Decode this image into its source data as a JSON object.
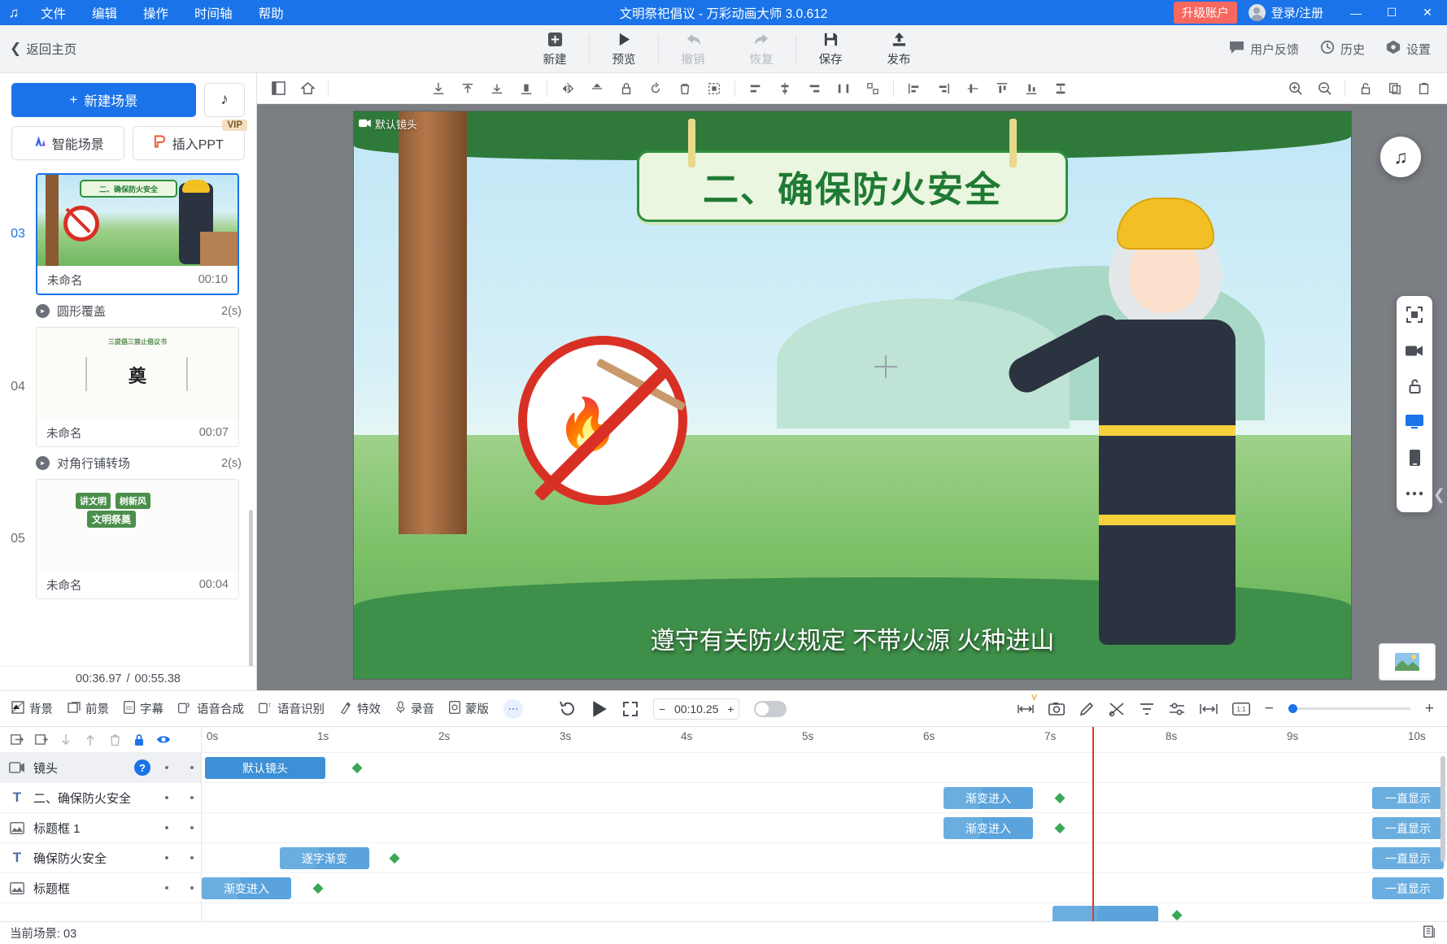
{
  "titlebar": {
    "logo": "brand-logo",
    "menus": [
      "文件",
      "编辑",
      "操作",
      "时间轴",
      "帮助"
    ],
    "title": "文明祭祀倡议 - 万彩动画大师 3.0.612",
    "upgrade": "升级账户",
    "account": "登录/注册",
    "minimize": "—",
    "maximize": "☐",
    "close": "✕",
    "accent": "#1a73e8",
    "upgrade_color": "#f8685f"
  },
  "toolbar": {
    "back_home": "返回主页",
    "items": [
      {
        "label": "新建",
        "icon": "plus-square-icon",
        "disabled": false
      },
      {
        "label": "预览",
        "icon": "play-icon",
        "disabled": false
      },
      {
        "label": "撤销",
        "icon": "undo-arrow-icon",
        "disabled": true
      },
      {
        "label": "恢复",
        "icon": "redo-arrow-icon",
        "disabled": true
      },
      {
        "label": "保存",
        "icon": "save-disk-icon",
        "disabled": false
      },
      {
        "label": "发布",
        "icon": "publish-upload-icon",
        "disabled": false
      }
    ],
    "right": [
      {
        "label": "用户反馈",
        "icon": "feedback-icon"
      },
      {
        "label": "历史",
        "icon": "history-clock-icon"
      },
      {
        "label": "设置",
        "icon": "gear-icon"
      }
    ]
  },
  "scenes_panel": {
    "new_scene": "新建场景",
    "music_icon": "music-note-icon",
    "smart_scene": "智能场景",
    "insert_ppt": "插入PPT",
    "vip_badge": "VIP",
    "items": [
      {
        "number": "03",
        "name": "未命名",
        "duration": "00:10",
        "selected": true,
        "thumb_title": "二、确保防火安全",
        "transition": {
          "name": "圆形覆盖",
          "duration": "2(s)"
        }
      },
      {
        "number": "04",
        "name": "未命名",
        "duration": "00:07",
        "selected": false,
        "thumb_title": "三提倡三禁止倡议书",
        "thumb_big_char": "奠",
        "transition": {
          "name": "对角行铺转场",
          "duration": "2(s)"
        }
      },
      {
        "number": "05",
        "name": "未命名",
        "duration": "00:04",
        "selected": false,
        "thumb_title_a": "讲文明",
        "thumb_title_b": "树新风",
        "thumb_title_c": "文明祭奠",
        "transition": null
      }
    ],
    "time_current": "00:36.97",
    "time_sep": "/",
    "time_total": "00:55.38"
  },
  "canvas": {
    "camera_badge": "默认镜头",
    "banner_text": "二、确保防火安全",
    "subtitle": "遵守有关防火规定 不带火源 火种进山",
    "music_fab_icon": "music-note-icon",
    "rail": [
      {
        "icon": "fit-screen-icon",
        "active": false
      },
      {
        "icon": "camera-pan-icon",
        "active": false
      },
      {
        "icon": "lock-open-icon",
        "active": false
      },
      {
        "icon": "desktop-screen-icon",
        "active": true
      },
      {
        "icon": "mobile-screen-icon",
        "active": false
      },
      {
        "icon": "more-dots-icon",
        "active": false
      }
    ],
    "mini_preview_icon": "image-thumbnail-icon"
  },
  "canvas_toolbar": {
    "groups": [
      [
        "layers-panel-icon",
        "home-anchor-icon"
      ],
      [
        "align-bottom-down-icon",
        "align-top-icon",
        "align-bottom-icon",
        "align-baseline-icon"
      ],
      [
        "flip-horizontal-icon",
        "flip-vertical-icon",
        "lock-icon",
        "rotate-icon",
        "delete-trash-icon",
        "group-icon"
      ],
      [
        "align-left-icon",
        "align-center-h-icon",
        "align-right-icon",
        "distribute-h-icon",
        "distribute-grid-icon",
        "align-left-edge-icon",
        "align-right-edge-icon",
        "align-center-v-icon",
        "align-top-edge-icon",
        "align-bottom-edge-icon",
        "distribute-v-icon"
      ],
      [
        "zoom-in-icon",
        "zoom-out-icon",
        "lock-ratio-icon",
        "copy-icon",
        "paste-icon"
      ]
    ]
  },
  "playbar": {
    "tools": [
      {
        "label": "背景",
        "icon": "background-icon"
      },
      {
        "label": "前景",
        "icon": "foreground-icon"
      },
      {
        "label": "字幕",
        "icon": "subtitle-cc-icon"
      },
      {
        "label": "语音合成",
        "icon": "tts-icon"
      },
      {
        "label": "语音识别",
        "icon": "speech-recognition-icon"
      },
      {
        "label": "特效",
        "icon": "effects-sparkle-icon"
      },
      {
        "label": "录音",
        "icon": "microphone-icon"
      },
      {
        "label": "蒙版",
        "icon": "mask-icon"
      }
    ],
    "more": "⋯",
    "replay_icon": "replay-icon",
    "play_icon": "play-icon",
    "fullscreen_icon": "expand-icon",
    "time_value": "00:10.25",
    "minus": "−",
    "plus": "+",
    "right_icons": [
      "fit-width-icon",
      "camera-snapshot-icon",
      "edit-pen-icon",
      "split-clip-icon",
      "filter-icon",
      "settings-sliders-icon",
      "frame-fit-icon",
      "one-to-one-icon"
    ],
    "zoom_out": "−",
    "zoom_in": "+",
    "badge_v": "V"
  },
  "timeline": {
    "tools": [
      "import-media-icon",
      "add-folder-icon",
      "move-down-icon",
      "move-up-icon",
      "delete-trash-icon",
      "lock-icon",
      "eye-visible-icon"
    ],
    "ruler": [
      "0s",
      "1s",
      "2s",
      "3s",
      "4s",
      "5s",
      "6s",
      "7s",
      "8s",
      "9s",
      "10s"
    ],
    "layers": [
      {
        "name": "镜头",
        "icon": "camera-track-icon",
        "selected": true,
        "has_help": true,
        "clips": [
          {
            "label": "默认镜头",
            "type": "cam",
            "start": 0.0,
            "end": 1.35
          }
        ],
        "keyframes": [
          1.55
        ],
        "always": null
      },
      {
        "name": "二、确保防火安全",
        "icon": "text-T-icon",
        "selected": false,
        "has_help": false,
        "clips": [
          {
            "label": "渐变进入",
            "type": "anim",
            "start": 6.15,
            "end": 6.75
          }
        ],
        "keyframes": [
          7.0
        ],
        "always": "一直显示"
      },
      {
        "name": "标题框 1",
        "icon": "image-layer-icon",
        "selected": false,
        "has_help": false,
        "clips": [
          {
            "label": "渐变进入",
            "type": "anim",
            "start": 6.15,
            "end": 6.75
          }
        ],
        "keyframes": [
          7.0
        ],
        "always": "一直显示"
      },
      {
        "name": "确保防火安全",
        "icon": "text-T-icon",
        "selected": false,
        "has_help": false,
        "clips": [
          {
            "label": "逐字渐变",
            "type": "anim",
            "start": 0.65,
            "end": 1.3
          }
        ],
        "keyframes": [
          1.5
        ],
        "always": "一直显示"
      },
      {
        "name": "标题框",
        "icon": "image-layer-icon",
        "selected": false,
        "has_help": false,
        "clips": [
          {
            "label": "渐变进入",
            "type": "anim",
            "start": 0.0,
            "end": 0.62
          }
        ],
        "keyframes": [
          0.9
        ],
        "always": "一直显示"
      }
    ],
    "playhead_time": "7.45",
    "footer_label": "当前场景: 03",
    "footer_icon": "duplicate-scene-icon"
  }
}
